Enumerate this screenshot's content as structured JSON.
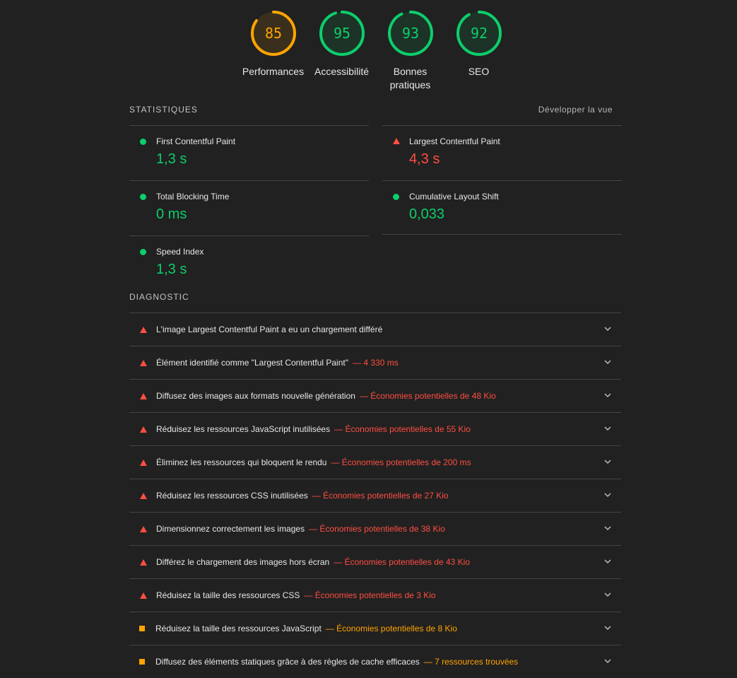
{
  "gauges": [
    {
      "score": "85",
      "label": "Performances",
      "fraction": 0.85,
      "color": "#ffa400",
      "fill": "#3a2f1c"
    },
    {
      "score": "95",
      "label": "Accessibilité",
      "fraction": 0.95,
      "color": "#0cce6b",
      "fill": "#1d3327"
    },
    {
      "score": "93",
      "label": "Bonnes pratiques",
      "fraction": 0.93,
      "color": "#0cce6b",
      "fill": "#1d3327"
    },
    {
      "score": "92",
      "label": "SEO",
      "fraction": 0.92,
      "color": "#0cce6b",
      "fill": "#1d3327"
    }
  ],
  "stats": {
    "title": "Statistiques",
    "expand_label": "Développer la vue",
    "metrics": [
      {
        "title": "First Contentful Paint",
        "value": "1,3 s",
        "status": "good"
      },
      {
        "title": "Largest Contentful Paint",
        "value": "4,3 s",
        "status": "bad"
      },
      {
        "title": "Total Blocking Time",
        "value": "0 ms",
        "status": "good"
      },
      {
        "title": "Cumulative Layout Shift",
        "value": "0,033",
        "status": "good"
      },
      {
        "title": "Speed Index",
        "value": "1,3 s",
        "status": "good"
      }
    ]
  },
  "diagnostic": {
    "title": "Diagnostic",
    "audits": [
      {
        "text": "L'image Largest Contentful Paint a eu un chargement différé",
        "detail": "",
        "status": "bad"
      },
      {
        "text": "Élément identifié comme \"Largest Contentful Paint\"",
        "detail": "— 4 330 ms",
        "status": "bad"
      },
      {
        "text": "Diffusez des images aux formats nouvelle génération",
        "detail": "— Économies potentielles de 48 Kio",
        "status": "bad"
      },
      {
        "text": "Réduisez les ressources JavaScript inutilisées",
        "detail": "— Économies potentielles de 55 Kio",
        "status": "bad"
      },
      {
        "text": "Éliminez les ressources qui bloquent le rendu",
        "detail": "— Économies potentielles de 200 ms",
        "status": "bad"
      },
      {
        "text": "Réduisez les ressources CSS inutilisées",
        "detail": "— Économies potentielles de 27 Kio",
        "status": "bad"
      },
      {
        "text": "Dimensionnez correctement les images",
        "detail": "— Économies potentielles de 38 Kio",
        "status": "bad"
      },
      {
        "text": "Différez le chargement des images hors écran",
        "detail": "— Économies potentielles de 43 Kio",
        "status": "bad"
      },
      {
        "text": "Réduisez la taille des ressources CSS",
        "detail": "— Économies potentielles de 3 Kio",
        "status": "bad"
      },
      {
        "text": "Réduisez la taille des ressources JavaScript",
        "detail": "— Économies potentielles de 8 Kio",
        "status": "average"
      },
      {
        "text": "Diffusez des éléments statiques grâce à des règles de cache efficaces",
        "detail": "— 7 ressources trouvées",
        "status": "average"
      }
    ]
  },
  "icons": {
    "expand": "chevron-down-icon",
    "fail": "triangle-icon",
    "pass": "circle-icon",
    "average": "square-icon"
  }
}
